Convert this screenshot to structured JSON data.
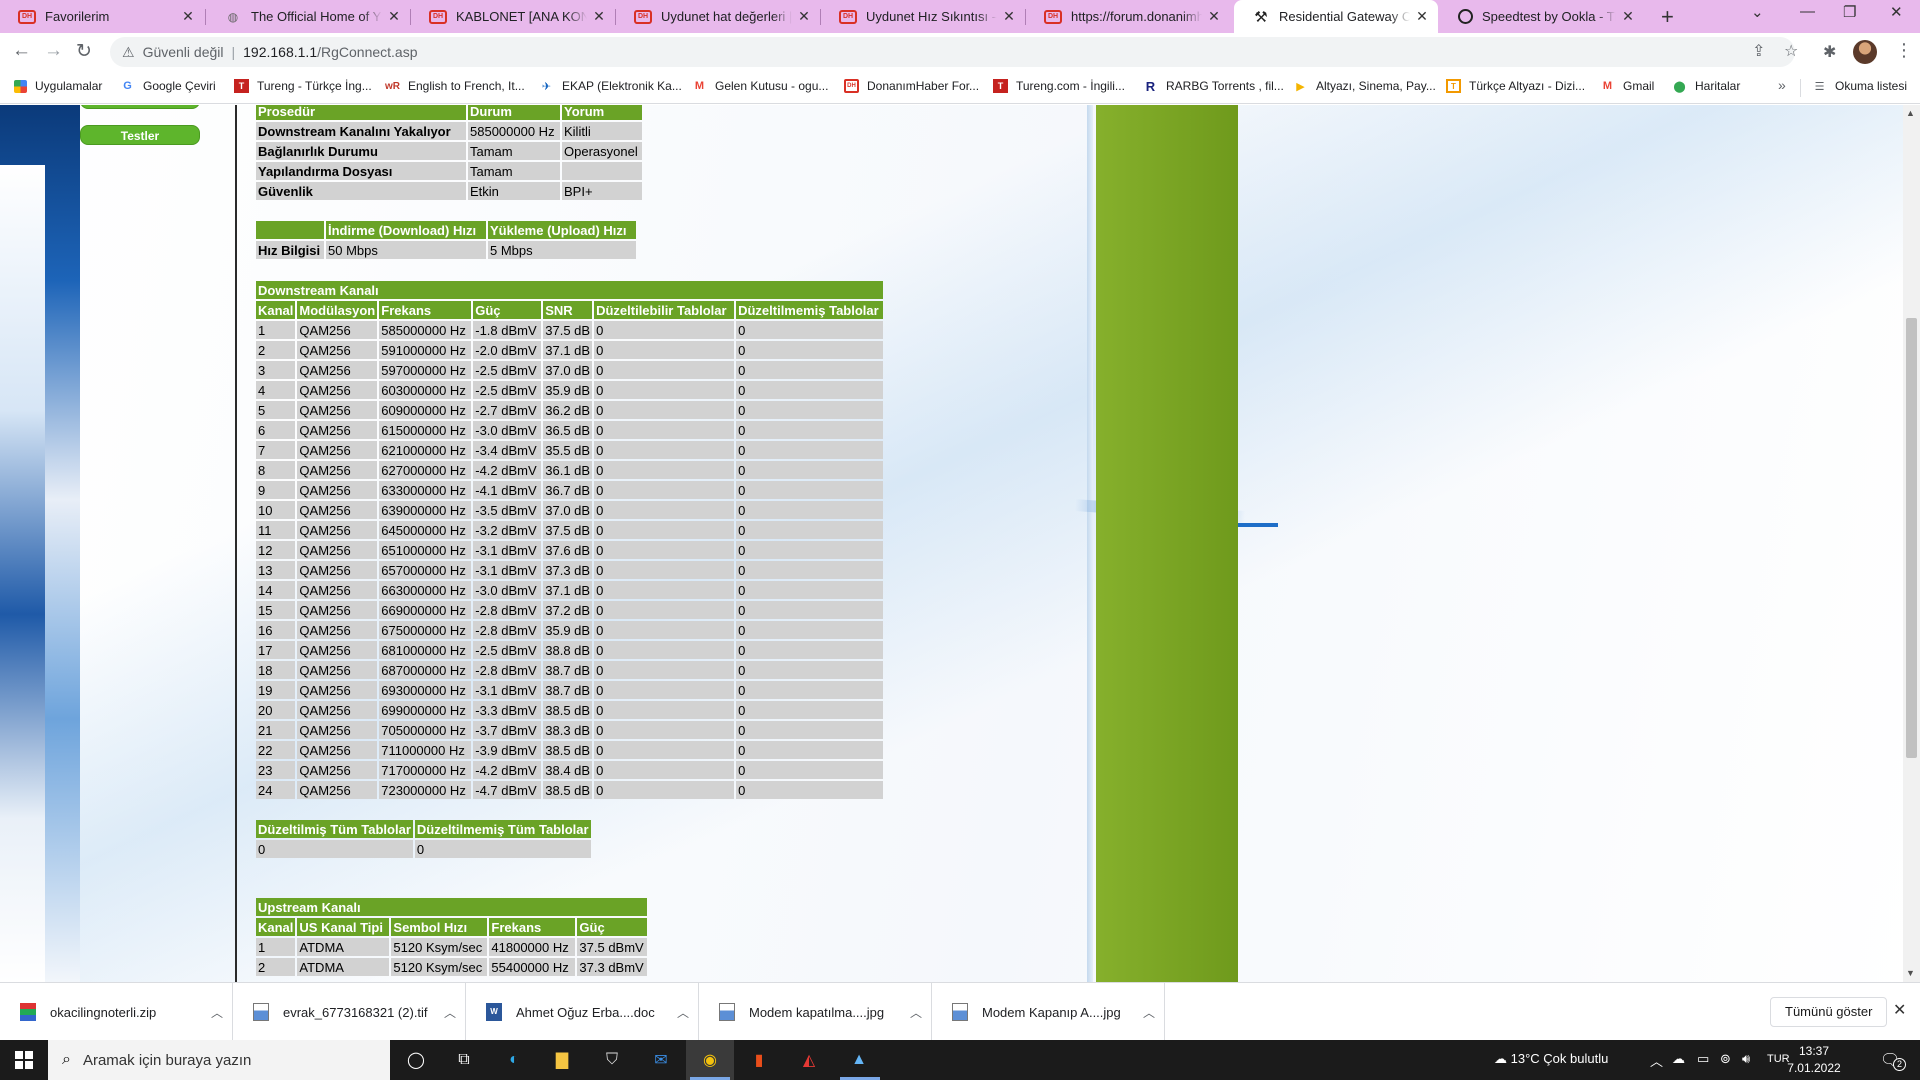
{
  "browser": {
    "tabs": [
      {
        "title": "Favorilerim",
        "icon": "donanimhaber-icon"
      },
      {
        "title": "The Official Home of YIFY M",
        "icon": "yify-icon"
      },
      {
        "title": "KABLONET [ANA KONU] | Sa",
        "icon": "donanimhaber-icon"
      },
      {
        "title": "Uydunet hat değerleri | Do",
        "icon": "donanimhaber-icon"
      },
      {
        "title": "Uydunet Hız Sıkıntısı -- ÇÖ",
        "icon": "donanimhaber-icon"
      },
      {
        "title": "https://forum.donanimhab",
        "icon": "donanimhaber-icon"
      },
      {
        "title": "Residential Gateway Config",
        "icon": "wrench-icon"
      },
      {
        "title": "Speedtest by Ookla - The G",
        "icon": "ookla-icon"
      }
    ],
    "new_tab": "+",
    "security_label": "Güvenli değil",
    "url_host": "192.168.1.1",
    "url_path": "/RgConnect.asp",
    "bookmarks": [
      {
        "label": "Uygulamalar",
        "icon": "apps-grid-icon"
      },
      {
        "label": "Google Çeviri",
        "icon": "google-translate-icon"
      },
      {
        "label": "Tureng - Türkçe İng...",
        "icon": "tureng-icon"
      },
      {
        "label": "English to French, It...",
        "icon": "wordreference-icon"
      },
      {
        "label": "EKAP (Elektronik Ka...",
        "icon": "ekap-icon"
      },
      {
        "label": "Gelen Kutusu - ogu...",
        "icon": "gmail-icon"
      },
      {
        "label": "DonanımHaber For...",
        "icon": "donanimhaber-icon"
      },
      {
        "label": "Tureng.com - İngili...",
        "icon": "tureng-icon"
      },
      {
        "label": "RARBG Torrents , fil...",
        "icon": "rarbg-icon"
      },
      {
        "label": "Altyazı, Sinema, Pay...",
        "icon": "altyazi-icon"
      },
      {
        "label": "Türkçe Altyazı - Dizi...",
        "icon": "turkcealtyazi-icon"
      },
      {
        "label": "Gmail",
        "icon": "gmail-icon"
      },
      {
        "label": "Haritalar",
        "icon": "maps-icon"
      }
    ],
    "reading_list": "Okuma listesi"
  },
  "page": {
    "side_button": "Testler",
    "procedure_table": {
      "headers": [
        "Prosedür",
        "Durum",
        "Yorum"
      ],
      "rows": [
        [
          "Downstream Kanalını Yakalıyor",
          "585000000 Hz",
          "Kilitli"
        ],
        [
          "Bağlanırlık Durumu",
          "Tamam",
          "Operasyonel"
        ],
        [
          "Yapılandırma Dosyası",
          "Tamam",
          ""
        ],
        [
          "Güvenlik",
          "Etkin",
          "BPI+"
        ]
      ]
    },
    "speed_table": {
      "headers": [
        "",
        "İndirme (Download) Hızı",
        "Yükleme (Upload) Hızı"
      ],
      "row": [
        "Hız Bilgisi",
        "50 Mbps",
        "5 Mbps"
      ]
    },
    "downstream": {
      "caption": "Downstream Kanalı",
      "headers": [
        "Kanal",
        "Modülasyon",
        "Frekans",
        "Güç",
        "SNR",
        "Düzeltilebilir Tablolar",
        "Düzeltilmemiş Tablolar"
      ],
      "rows": [
        [
          "1",
          "QAM256",
          "585000000 Hz",
          "-1.8 dBmV",
          "37.5 dB",
          "0",
          "0"
        ],
        [
          "2",
          "QAM256",
          "591000000 Hz",
          "-2.0 dBmV",
          "37.1 dB",
          "0",
          "0"
        ],
        [
          "3",
          "QAM256",
          "597000000 Hz",
          "-2.5 dBmV",
          "37.0 dB",
          "0",
          "0"
        ],
        [
          "4",
          "QAM256",
          "603000000 Hz",
          "-2.5 dBmV",
          "35.9 dB",
          "0",
          "0"
        ],
        [
          "5",
          "QAM256",
          "609000000 Hz",
          "-2.7 dBmV",
          "36.2 dB",
          "0",
          "0"
        ],
        [
          "6",
          "QAM256",
          "615000000 Hz",
          "-3.0 dBmV",
          "36.5 dB",
          "0",
          "0"
        ],
        [
          "7",
          "QAM256",
          "621000000 Hz",
          "-3.4 dBmV",
          "35.5 dB",
          "0",
          "0"
        ],
        [
          "8",
          "QAM256",
          "627000000 Hz",
          "-4.2 dBmV",
          "36.1 dB",
          "0",
          "0"
        ],
        [
          "9",
          "QAM256",
          "633000000 Hz",
          "-4.1 dBmV",
          "36.7 dB",
          "0",
          "0"
        ],
        [
          "10",
          "QAM256",
          "639000000 Hz",
          "-3.5 dBmV",
          "37.0 dB",
          "0",
          "0"
        ],
        [
          "11",
          "QAM256",
          "645000000 Hz",
          "-3.2 dBmV",
          "37.5 dB",
          "0",
          "0"
        ],
        [
          "12",
          "QAM256",
          "651000000 Hz",
          "-3.1 dBmV",
          "37.6 dB",
          "0",
          "0"
        ],
        [
          "13",
          "QAM256",
          "657000000 Hz",
          "-3.1 dBmV",
          "37.3 dB",
          "0",
          "0"
        ],
        [
          "14",
          "QAM256",
          "663000000 Hz",
          "-3.0 dBmV",
          "37.1 dB",
          "0",
          "0"
        ],
        [
          "15",
          "QAM256",
          "669000000 Hz",
          "-2.8 dBmV",
          "37.2 dB",
          "0",
          "0"
        ],
        [
          "16",
          "QAM256",
          "675000000 Hz",
          "-2.8 dBmV",
          "35.9 dB",
          "0",
          "0"
        ],
        [
          "17",
          "QAM256",
          "681000000 Hz",
          "-2.5 dBmV",
          "38.8 dB",
          "0",
          "0"
        ],
        [
          "18",
          "QAM256",
          "687000000 Hz",
          "-2.8 dBmV",
          "38.7 dB",
          "0",
          "0"
        ],
        [
          "19",
          "QAM256",
          "693000000 Hz",
          "-3.1 dBmV",
          "38.7 dB",
          "0",
          "0"
        ],
        [
          "20",
          "QAM256",
          "699000000 Hz",
          "-3.3 dBmV",
          "38.5 dB",
          "0",
          "0"
        ],
        [
          "21",
          "QAM256",
          "705000000 Hz",
          "-3.7 dBmV",
          "38.3 dB",
          "0",
          "0"
        ],
        [
          "22",
          "QAM256",
          "711000000 Hz",
          "-3.9 dBmV",
          "38.5 dB",
          "0",
          "0"
        ],
        [
          "23",
          "QAM256",
          "717000000 Hz",
          "-4.2 dBmV",
          "38.4 dB",
          "0",
          "0"
        ],
        [
          "24",
          "QAM256",
          "723000000 Hz",
          "-4.7 dBmV",
          "38.5 dB",
          "0",
          "0"
        ]
      ]
    },
    "totals_table": {
      "headers": [
        "Düzeltilmiş Tüm Tablolar",
        "Düzeltilmemiş Tüm Tablolar"
      ],
      "row": [
        "0",
        "0"
      ]
    },
    "upstream": {
      "caption": "Upstream Kanalı",
      "headers": [
        "Kanal",
        "US Kanal Tipi",
        "Sembol Hızı",
        "Frekans",
        "Güç"
      ],
      "rows": [
        [
          "1",
          "ATDMA",
          "5120 Ksym/sec",
          "41800000 Hz",
          "37.5 dBmV"
        ],
        [
          "2",
          "ATDMA",
          "5120 Ksym/sec",
          "55400000 Hz",
          "37.3 dBmV"
        ]
      ]
    }
  },
  "downloads": {
    "items": [
      {
        "name": "okacilingnoterli.zip",
        "icon": "zip-file-icon"
      },
      {
        "name": "evrak_6773168321 (2).tif",
        "icon": "image-file-icon"
      },
      {
        "name": "Ahmet Oğuz Erba....doc",
        "icon": "word-file-icon"
      },
      {
        "name": "Modem kapatılma....jpg",
        "icon": "image-file-icon"
      },
      {
        "name": "Modem Kapanıp A....jpg",
        "icon": "image-file-icon"
      }
    ],
    "show_all": "Tümünü göster"
  },
  "taskbar": {
    "search_placeholder": "Aramak için buraya yazın",
    "weather": "13°C  Çok bulutlu",
    "language": "TUR",
    "time": "13:37",
    "date": "7.01.2022",
    "notification_count": "2"
  }
}
